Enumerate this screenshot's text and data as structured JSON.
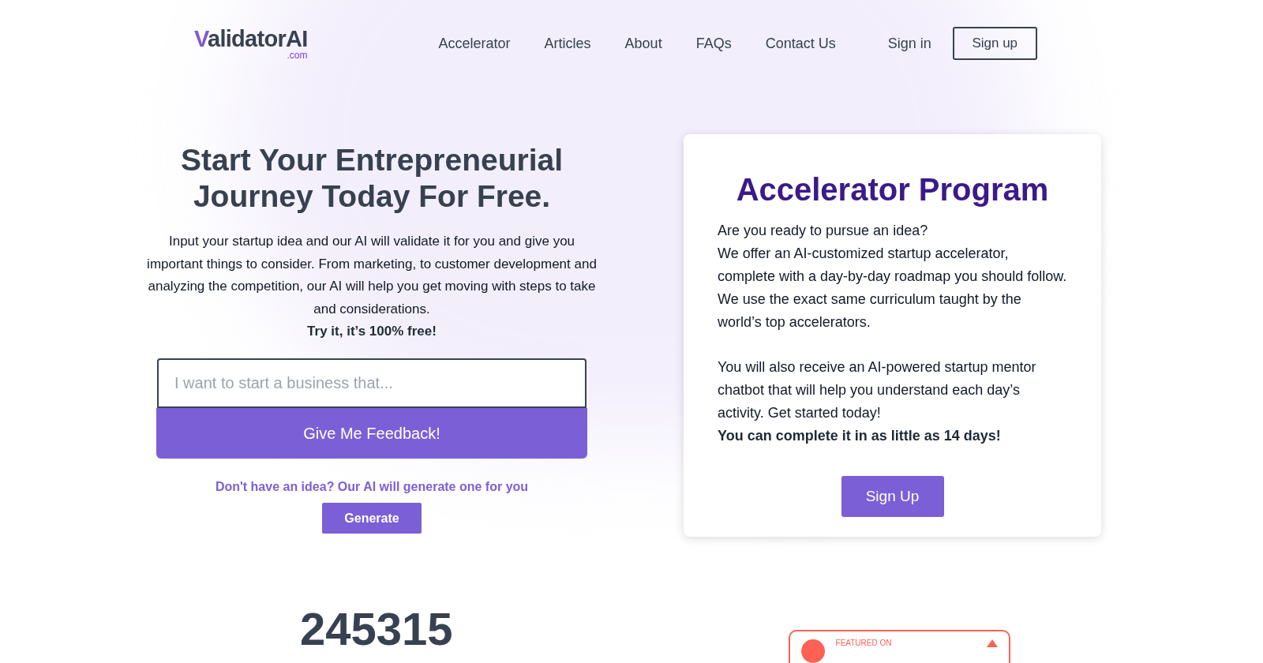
{
  "logo": {
    "text": "ValidatorAI",
    "suffix": ".com"
  },
  "nav": {
    "links": [
      "Accelerator",
      "Articles",
      "About",
      "FAQs",
      "Contact Us"
    ],
    "sign_in": "Sign in",
    "sign_up": "Sign up"
  },
  "hero": {
    "title": "Start Your Entrepreneurial Journey Today For Free.",
    "description": "Input your startup idea and our AI will validate it for you and give you important things to consider. From marketing, to customer development and analyzing the competition, our AI will help you get moving with steps to take and considerations.",
    "emphasis": "Try it, it’s 100% free!",
    "input": {
      "placeholder": "I want to start a business that..."
    },
    "submit": "Give Me Feedback!",
    "generate_prompt": "Don't have an idea? Our AI will generate one for you",
    "generate": "Generate"
  },
  "card": {
    "title": "Accelerator Program",
    "paragraphs": [
      "Are you ready to pursue an idea?\nWe offer an AI-customized startup accelerator, complete with a day-by-day roadmap you should follow. We use the exact same curriculum taught by the world’s top accelerators.",
      "You will also receive an AI-powered startup mentor chatbot that will help you understand each day’s activity. Get started today!"
    ],
    "emphasis": "You can complete it in as little as 14 days!",
    "button": "Sign Up"
  },
  "counter": "245315",
  "badge": {
    "label": "FEATURED ON"
  }
}
